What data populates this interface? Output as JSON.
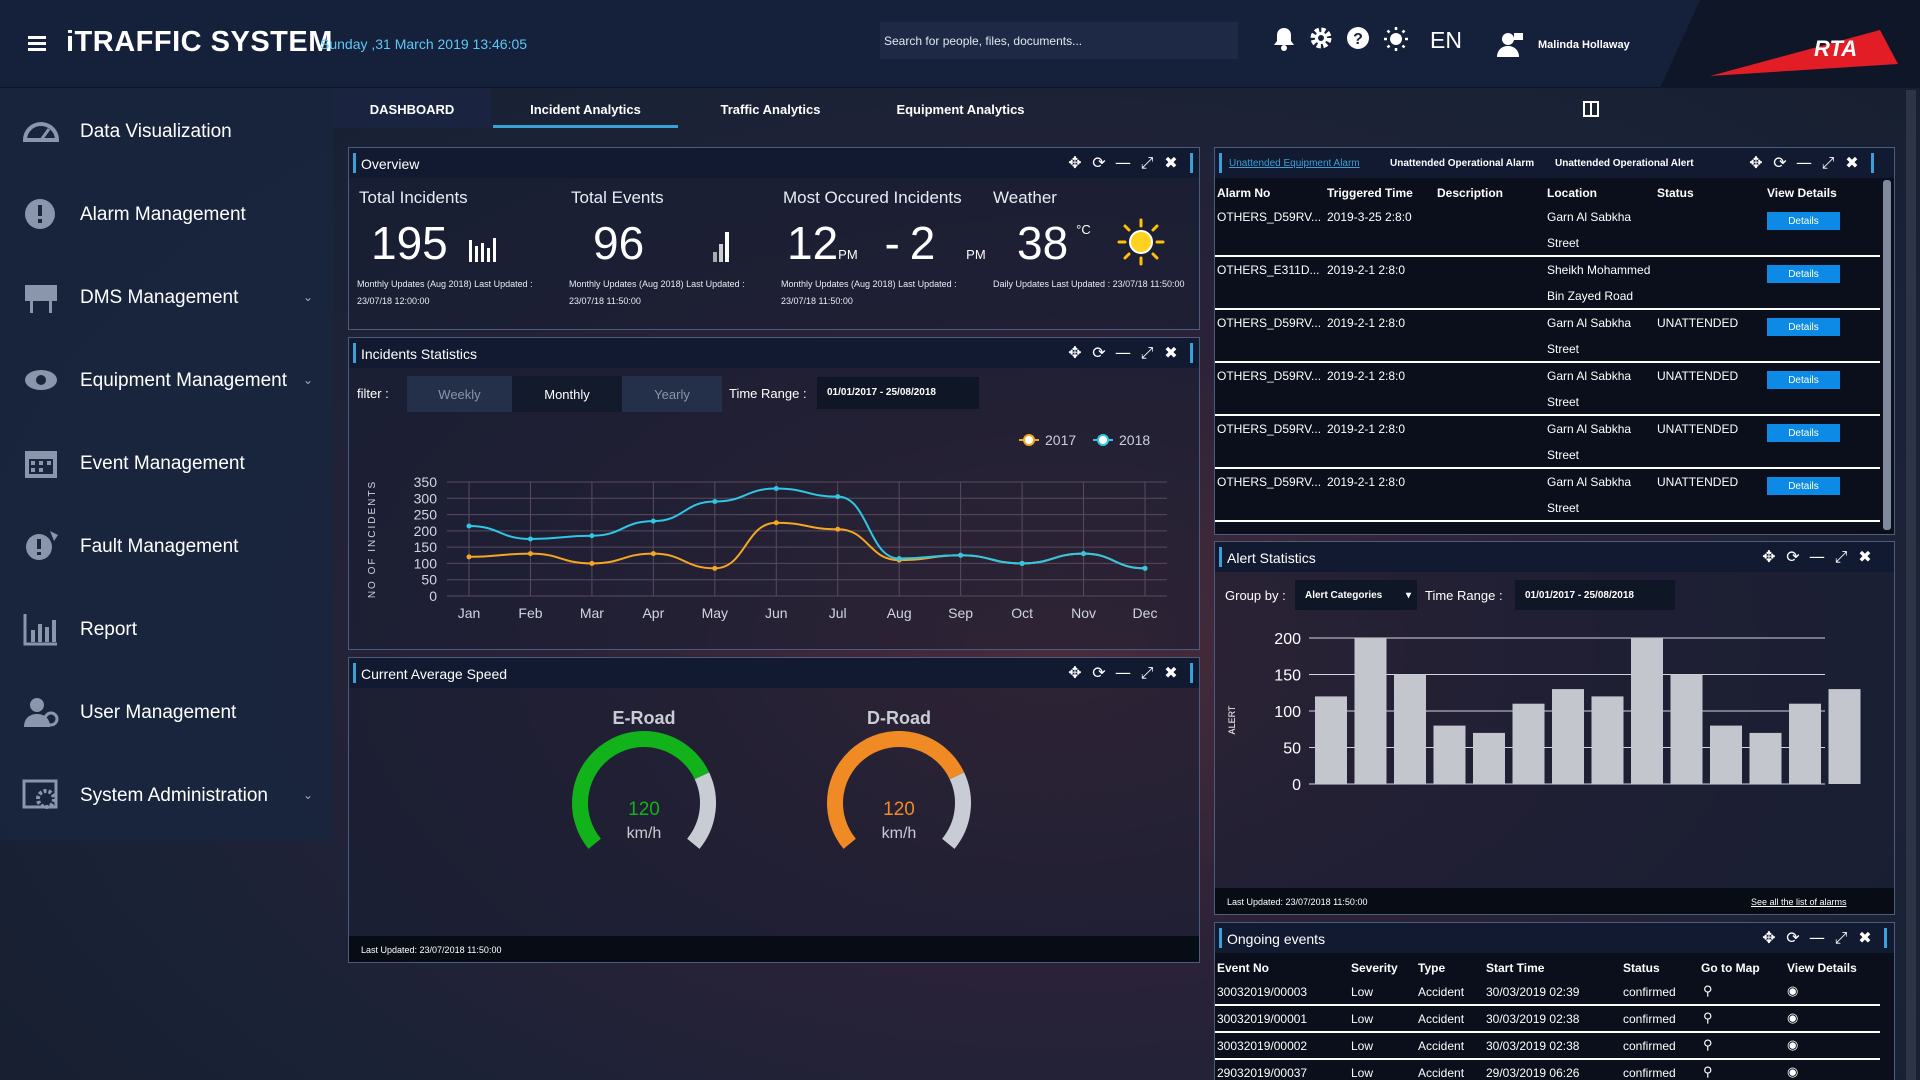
{
  "header": {
    "app_title": "iTRAFFIC SYSTEM",
    "datetime": "Sunday ,31 March 2019 13:46:05",
    "search_placeholder": "Search for people, files, documents...",
    "language": "EN",
    "user_name": "Malinda Hollaway",
    "brand_logo": "RTA",
    "icons": [
      "menu-icon",
      "bell-icon",
      "gear-icon",
      "help-icon",
      "brightness-icon",
      "user-icon"
    ]
  },
  "sidebar": {
    "items": [
      {
        "label": "Data Visualization",
        "icon": "gauge-icon",
        "expandable": false
      },
      {
        "label": "Alarm Management",
        "icon": "alert-icon",
        "expandable": false
      },
      {
        "label": "DMS Management",
        "icon": "sign-board-icon",
        "expandable": true
      },
      {
        "label": "Equipment Management",
        "icon": "camera-icon",
        "expandable": true
      },
      {
        "label": "Event Management",
        "icon": "calendar-icon",
        "expandable": false
      },
      {
        "label": "Fault Management",
        "icon": "fault-icon",
        "expandable": false
      },
      {
        "label": "Report",
        "icon": "report-icon",
        "expandable": false
      },
      {
        "label": "User Management",
        "icon": "users-icon",
        "expandable": false
      },
      {
        "label": "System Administration",
        "icon": "admin-icon",
        "expandable": true
      }
    ]
  },
  "tabs": [
    {
      "label": "DASHBOARD",
      "active": false
    },
    {
      "label": "Incident Analytics",
      "active": true
    },
    {
      "label": "Traffic Analytics",
      "active": false
    },
    {
      "label": "Equipment Analytics",
      "active": false
    }
  ],
  "overview": {
    "title": "Overview",
    "total_incidents": {
      "label": "Total Incidents",
      "value": "195",
      "note1": "Monthly Updates (Aug 2018) Last Updated :",
      "note2": "23/07/18 12:00:00"
    },
    "total_events": {
      "label": "Total Events",
      "value": "96",
      "note1": "Monthly Updates (Aug 2018) Last Updated :",
      "note2": "23/07/18 11:50:00"
    },
    "most_occured": {
      "label": "Most Occured Incidents",
      "from": "12",
      "from_unit": "PM",
      "sep": "-",
      "to": "2",
      "to_unit": "PM",
      "note1": "Monthly Updates (Aug 2018) Last Updated :",
      "note2": "23/07/18 11:50:00"
    },
    "weather": {
      "label": "Weather",
      "value": "38",
      "unit": "°C",
      "note1": "Daily Updates Last Updated : 23/07/18 11:50:00"
    }
  },
  "incidents": {
    "title": "Incidents Statistics",
    "filter_label": "filter :",
    "filters": [
      "Weekly",
      "Monthly",
      "Yearly"
    ],
    "active_filter": "Monthly",
    "time_range_label": "Time Range :",
    "time_range": "01/01/2017 - 25/08/2018"
  },
  "chart_data": {
    "type": "line",
    "ylabel": "NO OF INCIDENTS",
    "ylim": [
      0,
      350
    ],
    "yticks": [
      0,
      50,
      100,
      150,
      200,
      250,
      300,
      350
    ],
    "categories": [
      "Jan",
      "Feb",
      "Mar",
      "Apr",
      "May",
      "Jun",
      "Jul",
      "Aug",
      "Sep",
      "Oct",
      "Nov",
      "Dec"
    ],
    "series": [
      {
        "name": "2017",
        "color": "#f5a623",
        "values": [
          120,
          130,
          100,
          130,
          85,
          225,
          205,
          110,
          125,
          100,
          130,
          85
        ]
      },
      {
        "name": "2018",
        "color": "#2fc7e6",
        "values": [
          215,
          175,
          185,
          230,
          290,
          330,
          305,
          115,
          125,
          100,
          130,
          85
        ]
      }
    ],
    "legend": "top-right",
    "grid": true
  },
  "speed": {
    "title": "Current Average Speed",
    "gauges": [
      {
        "label": "E-Road",
        "value": "120",
        "unit": "km/h",
        "fraction": 0.75,
        "color": "#12b21a"
      },
      {
        "label": "D-Road",
        "value": "120",
        "unit": "km/h",
        "fraction": 0.75,
        "color": "#f08a24"
      }
    ],
    "last_updated": "Last Updated: 23/07/2018 11:50:00"
  },
  "alarms": {
    "tabs": [
      "Unattended Equipment Alarm",
      "Unattended Operational Alarm",
      "Unattended Operational Alert"
    ],
    "columns": [
      "Alarm No",
      "Triggered Time",
      "Description",
      "Location",
      "Status",
      "View Details"
    ],
    "details_label": "Details",
    "rows": [
      {
        "no": "OTHERS_D59RV...",
        "time": "2019-3-25 2:8:0",
        "desc": "",
        "loc1": "Garn Al Sabkha",
        "loc2": "Street",
        "status": ""
      },
      {
        "no": "OTHERS_E311D...",
        "time": "2019-2-1 2:8:0",
        "desc": "",
        "loc1": "Sheikh Mohammed",
        "loc2": "Bin Zayed Road",
        "status": ""
      },
      {
        "no": "OTHERS_D59RV...",
        "time": "2019-2-1 2:8:0",
        "desc": "",
        "loc1": "Garn Al Sabkha",
        "loc2": "Street",
        "status": "UNATTENDED"
      },
      {
        "no": "OTHERS_D59RV...",
        "time": "2019-2-1 2:8:0",
        "desc": "",
        "loc1": "Garn Al Sabkha",
        "loc2": "Street",
        "status": "UNATTENDED"
      },
      {
        "no": "OTHERS_D59RV...",
        "time": "2019-2-1 2:8:0",
        "desc": "",
        "loc1": "Garn Al Sabkha",
        "loc2": "Street",
        "status": "UNATTENDED"
      },
      {
        "no": "OTHERS_D59RV...",
        "time": "2019-2-1 2:8:0",
        "desc": "",
        "loc1": "Garn Al Sabkha",
        "loc2": "Street",
        "status": "UNATTENDED"
      }
    ]
  },
  "alert_stats": {
    "title": "Alert Statistics",
    "group_by_label": "Group by :",
    "group_by_value": "Alert Categories",
    "time_range_label": "Time Range :",
    "time_range": "01/01/2017  -  25/08/2018",
    "ylabel": "ALERT",
    "yticks": [
      0,
      50,
      100,
      150,
      200
    ],
    "values": [
      120,
      200,
      150,
      80,
      70,
      110,
      130,
      120,
      200,
      150,
      80,
      70,
      110,
      130
    ],
    "ymax": 200,
    "bar_color": "#c3c7cd",
    "last_updated": "Last Updated: 23/07/2018 11:50:00",
    "see_all": "See all the list of alarms"
  },
  "events": {
    "title": "Ongoing events",
    "columns": [
      "Event No",
      "Severity",
      "Type",
      "Start Time",
      "Status",
      "Go to Map",
      "View Details"
    ],
    "rows": [
      {
        "no": "30032019/00003",
        "severity": "Low",
        "type": "Accident",
        "start": "30/03/2019 02:39",
        "status": "confirmed"
      },
      {
        "no": "30032019/00001",
        "severity": "Low",
        "type": "Accident",
        "start": "30/03/2019 02:38",
        "status": "confirmed"
      },
      {
        "no": "30032019/00002",
        "severity": "Low",
        "type": "Accident",
        "start": "30/03/2019 02:38",
        "status": "confirmed"
      },
      {
        "no": "29032019/00037",
        "severity": "Low",
        "type": "Accident",
        "start": "29/03/2019 06:26",
        "status": "confirmed"
      }
    ]
  }
}
